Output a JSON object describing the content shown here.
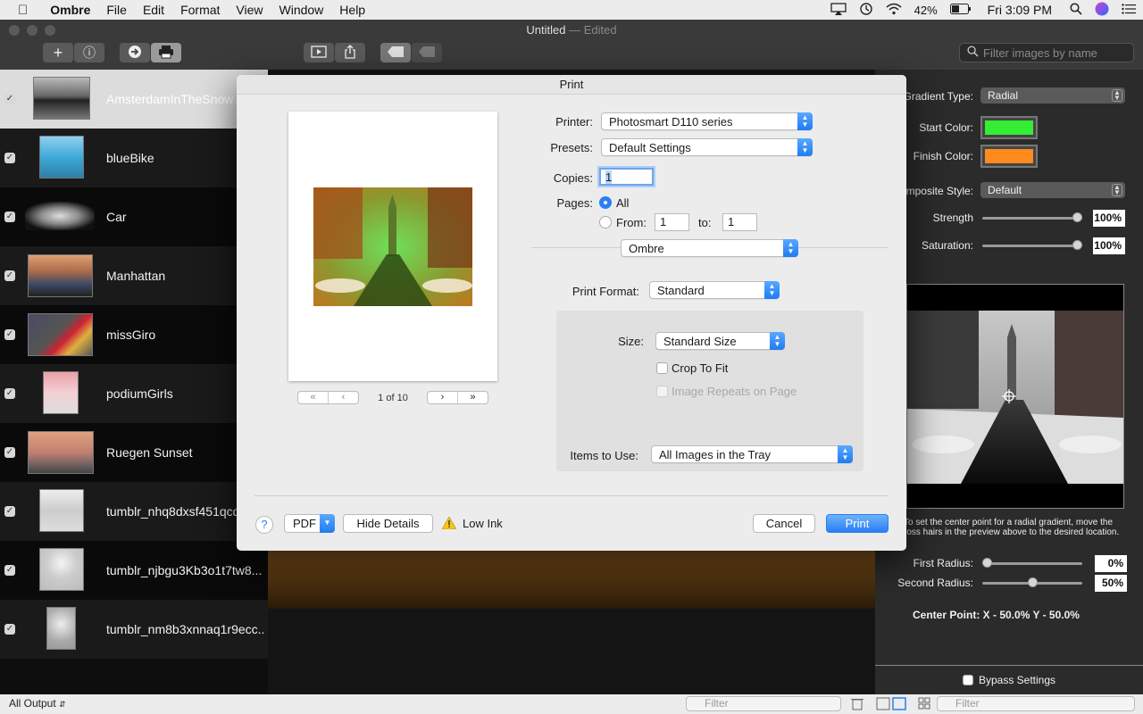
{
  "menubar": {
    "app_name": "Ombre",
    "items": [
      "File",
      "Edit",
      "Format",
      "View",
      "Window",
      "Help"
    ],
    "battery": "42%",
    "clock": "Fri 3:09 PM"
  },
  "window": {
    "title": "Untitled",
    "title_status": "— Edited",
    "filter_placeholder": "Filter images by name"
  },
  "sidebar": {
    "items": [
      {
        "label": "AmsterdamInTheSnow",
        "checked": true
      },
      {
        "label": "blueBike",
        "checked": true
      },
      {
        "label": "Car",
        "checked": true
      },
      {
        "label": "Manhattan",
        "checked": true
      },
      {
        "label": "missGiro",
        "checked": true
      },
      {
        "label": "podiumGirls",
        "checked": true
      },
      {
        "label": "Ruegen Sunset",
        "checked": true
      },
      {
        "label": "tumblr_nhq8dxsf451qcq",
        "checked": true
      },
      {
        "label": "tumblr_njbgu3Kb3o1t7tw8...",
        "checked": true
      },
      {
        "label": "tumblr_nm8b3xnnaq1r9ecc...",
        "checked": true
      }
    ]
  },
  "right_panel": {
    "gradient_type_label": "Gradient Type:",
    "gradient_type_value": "Radial",
    "start_color_label": "Start Color:",
    "start_color": "#33ee33",
    "finish_color_label": "Finish Color:",
    "finish_color": "#ff8a1e",
    "composite_style_label": "omposite Style:",
    "composite_style_value": "Default",
    "strength_label": "Strength",
    "strength_value": "100%",
    "strength_fraction": 1.0,
    "saturation_label": "Saturation:",
    "saturation_value": "100%",
    "saturation_fraction": 1.0,
    "hint_line1": "To set the center point  for a radial gradient, move the",
    "hint_line2": "ross hairs in the preview above to the desired location.",
    "first_radius_label": "First Radius:",
    "first_radius_value": "0%",
    "first_radius_fraction": 0.0,
    "second_radius_label": "Second Radius:",
    "second_radius_value": "50%",
    "second_radius_fraction": 0.5,
    "center_point": "Center Point:  X - 50.0%   Y - 50.0%",
    "bypass_label": "Bypass Settings"
  },
  "bottom_bar": {
    "output_label": "All Output",
    "filter1_placeholder": "Filter",
    "filter2_placeholder": "Filter"
  },
  "print_dialog": {
    "title": "Print",
    "page_indicator": "1 of 10",
    "printer_label": "Printer:",
    "printer_value": "Photosmart D110 series",
    "presets_label": "Presets:",
    "presets_value": "Default Settings",
    "copies_label": "Copies:",
    "copies_value": "1",
    "pages_label": "Pages:",
    "pages_all": "All",
    "pages_from": "From:",
    "pages_from_value": "1",
    "pages_to": "to:",
    "pages_to_value": "1",
    "section_value": "Ombre",
    "print_format_label": "Print Format:",
    "print_format_value": "Standard",
    "size_label": "Size:",
    "size_value": "Standard Size",
    "crop_label": "Crop To Fit",
    "repeat_label": "Image Repeats on Page",
    "items_label": "Items to Use:",
    "items_value": "All Images in the Tray",
    "help_label": "?",
    "pdf_label": "PDF",
    "hide_details_label": "Hide Details",
    "low_ink_label": "Low Ink",
    "cancel_label": "Cancel",
    "print_label": "Print"
  }
}
